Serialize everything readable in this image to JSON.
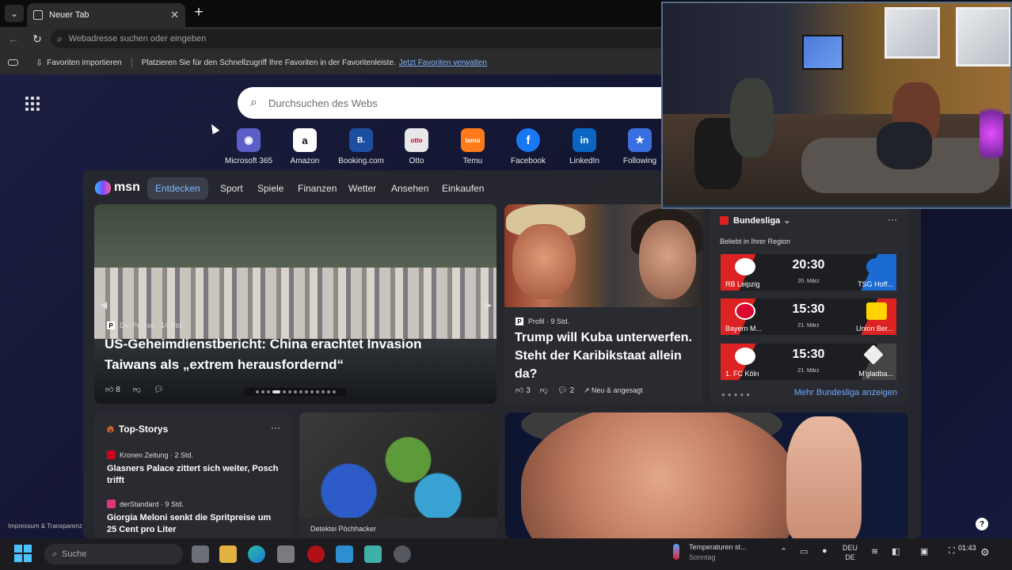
{
  "browser": {
    "tab_title": "Neuer Tab",
    "new_tab_symbol": "+",
    "address_placeholder": "Webadresse suchen oder eingeben",
    "favorites": {
      "import_label": "Favoriten importieren",
      "hint": "Platzieren Sie für den Schnellzugriff Ihre Favoriten in der Favoritenleiste.",
      "manage_link": "Jetzt Favoriten verwalten"
    }
  },
  "newtab": {
    "search_placeholder": "Durchsuchen des Webs",
    "quick_links": [
      {
        "label": "Microsoft 365",
        "icon": "microsoft365-icon",
        "color": "#5b5fc7"
      },
      {
        "label": "Amazon",
        "icon": "amazon-icon",
        "color": "#ffffff"
      },
      {
        "label": "Booking.com",
        "icon": "booking-icon",
        "color": "#1d4fa0"
      },
      {
        "label": "Otto",
        "icon": "otto-icon",
        "color": "#e8e8e8"
      },
      {
        "label": "Temu",
        "icon": "temu-icon",
        "color": "#ff7a1a"
      },
      {
        "label": "Facebook",
        "icon": "facebook-icon",
        "color": "#1877f2"
      },
      {
        "label": "LinkedIn",
        "icon": "linkedin-icon",
        "color": "#0a66c2"
      },
      {
        "label": "Following",
        "icon": "following-icon",
        "color": "#3a6fe0"
      }
    ],
    "quick_link_glyphs": [
      "◉",
      "a",
      "B.",
      "otto",
      "temu",
      "f",
      "in",
      "★"
    ],
    "impressum": "Impressum & Transparenz"
  },
  "msn": {
    "logo": "msn",
    "nav": [
      "Entdecken",
      "Sport",
      "Spiele",
      "Finanzen",
      "Wetter",
      "Ansehen",
      "Einkaufen"
    ],
    "hero": {
      "source": "Die Presse",
      "time": "14 Std.",
      "source_glyph": "P",
      "headline": "US-Geheimdienstbericht: China erachtet Invasion Taiwans als „extrem herausfordernd“",
      "likes": "8"
    },
    "card2": {
      "source": "Profil",
      "time": "9 Std.",
      "source_glyph": "P",
      "headline": "Trump will Kuba unterwerfen. Steht der Karibikstaat allein da?",
      "likes": "3",
      "comments": "2",
      "badge": "Neu & angesagt"
    },
    "bundesliga": {
      "title": "Bundesliga",
      "subtitle": "Beliebt in Ihrer Region",
      "more_link": "Mehr Bundesliga anzeigen",
      "matches": [
        {
          "home": "RB Leipzig",
          "away": "TSG Hoff...",
          "time": "20:30",
          "date": "20. März"
        },
        {
          "home": "Bayern M...",
          "away": "Union Ber...",
          "time": "15:30",
          "date": "21. März"
        },
        {
          "home": "1. FC Köln",
          "away": "M'gladba...",
          "time": "15:30",
          "date": "21. März"
        }
      ]
    },
    "top_stories": {
      "title": "Top-Storys",
      "items": [
        {
          "source": "Kronen Zeitung",
          "time": "2 Std.",
          "headline": "Glasners Palace zittert sich weiter, Posch trifft",
          "color": "#d0021b"
        },
        {
          "source": "derStandard",
          "time": "9 Std.",
          "headline": "Giorgia Meloni senkt die Spritpreise um 25 Cent pro Liter",
          "color": "#e0357a"
        }
      ]
    },
    "card4": {
      "caption": "Detektei Pöchhacker"
    }
  },
  "taskbar": {
    "search_label": "Suche",
    "weather": {
      "line1": "Temperaturen st...",
      "line2": "Sonntag"
    },
    "lang": {
      "line1": "DEU",
      "line2": "DE"
    },
    "time": "01:43"
  }
}
